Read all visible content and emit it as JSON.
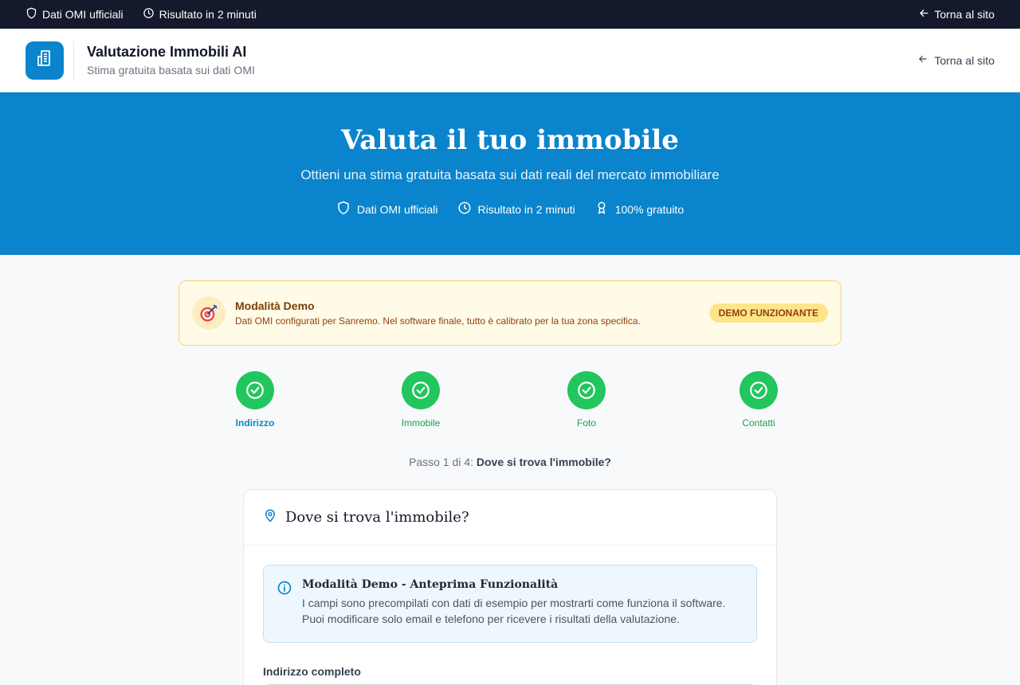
{
  "topbar": {
    "items": [
      "Dati OMI ufficiali",
      "Risultato in 2 minuti"
    ],
    "back_label": "Torna al sito"
  },
  "header": {
    "title": "Valutazione Immobili AI",
    "subtitle": "Stima gratuita basata sui dati OMI",
    "back_label": "Torna al sito"
  },
  "hero": {
    "title": "Valuta il tuo immobile",
    "subtitle": "Ottieni una stima gratuita basata sui dati reali del mercato immobiliare",
    "features": [
      "Dati OMI ufficiali",
      "Risultato in 2 minuti",
      "100% gratuito"
    ]
  },
  "demo_banner": {
    "title": "Modalità Demo",
    "description": "Dati OMI configurati per Sanremo. Nel software finale, tutto è calibrato per la tua zona specifica.",
    "badge": "DEMO FUNZIONANTE"
  },
  "steps": [
    {
      "label": "Indirizzo",
      "active": true
    },
    {
      "label": "Immobile"
    },
    {
      "label": "Foto"
    },
    {
      "label": "Contatti"
    }
  ],
  "progress": {
    "prefix": "Passo 1 di 4:",
    "step_title": "Dove si trova l'immobile?"
  },
  "card": {
    "title": "Dove si trova l'immobile?",
    "info_title": "Modalità Demo - Anteprima Funzionalità",
    "info_line1": "I campi sono precompilati con dati di esempio per mostrarti come funziona il software.",
    "info_line2": "Puoi modificare solo email e telefono per ricevere i risultati della valutazione.",
    "address_label": "Indirizzo completo"
  },
  "colors": {
    "primary": "#0a84cc",
    "topbar": "#141a2b",
    "success": "#22c55e",
    "demo_bg": "#fffbe6",
    "demo_badge": "#fde68a"
  }
}
